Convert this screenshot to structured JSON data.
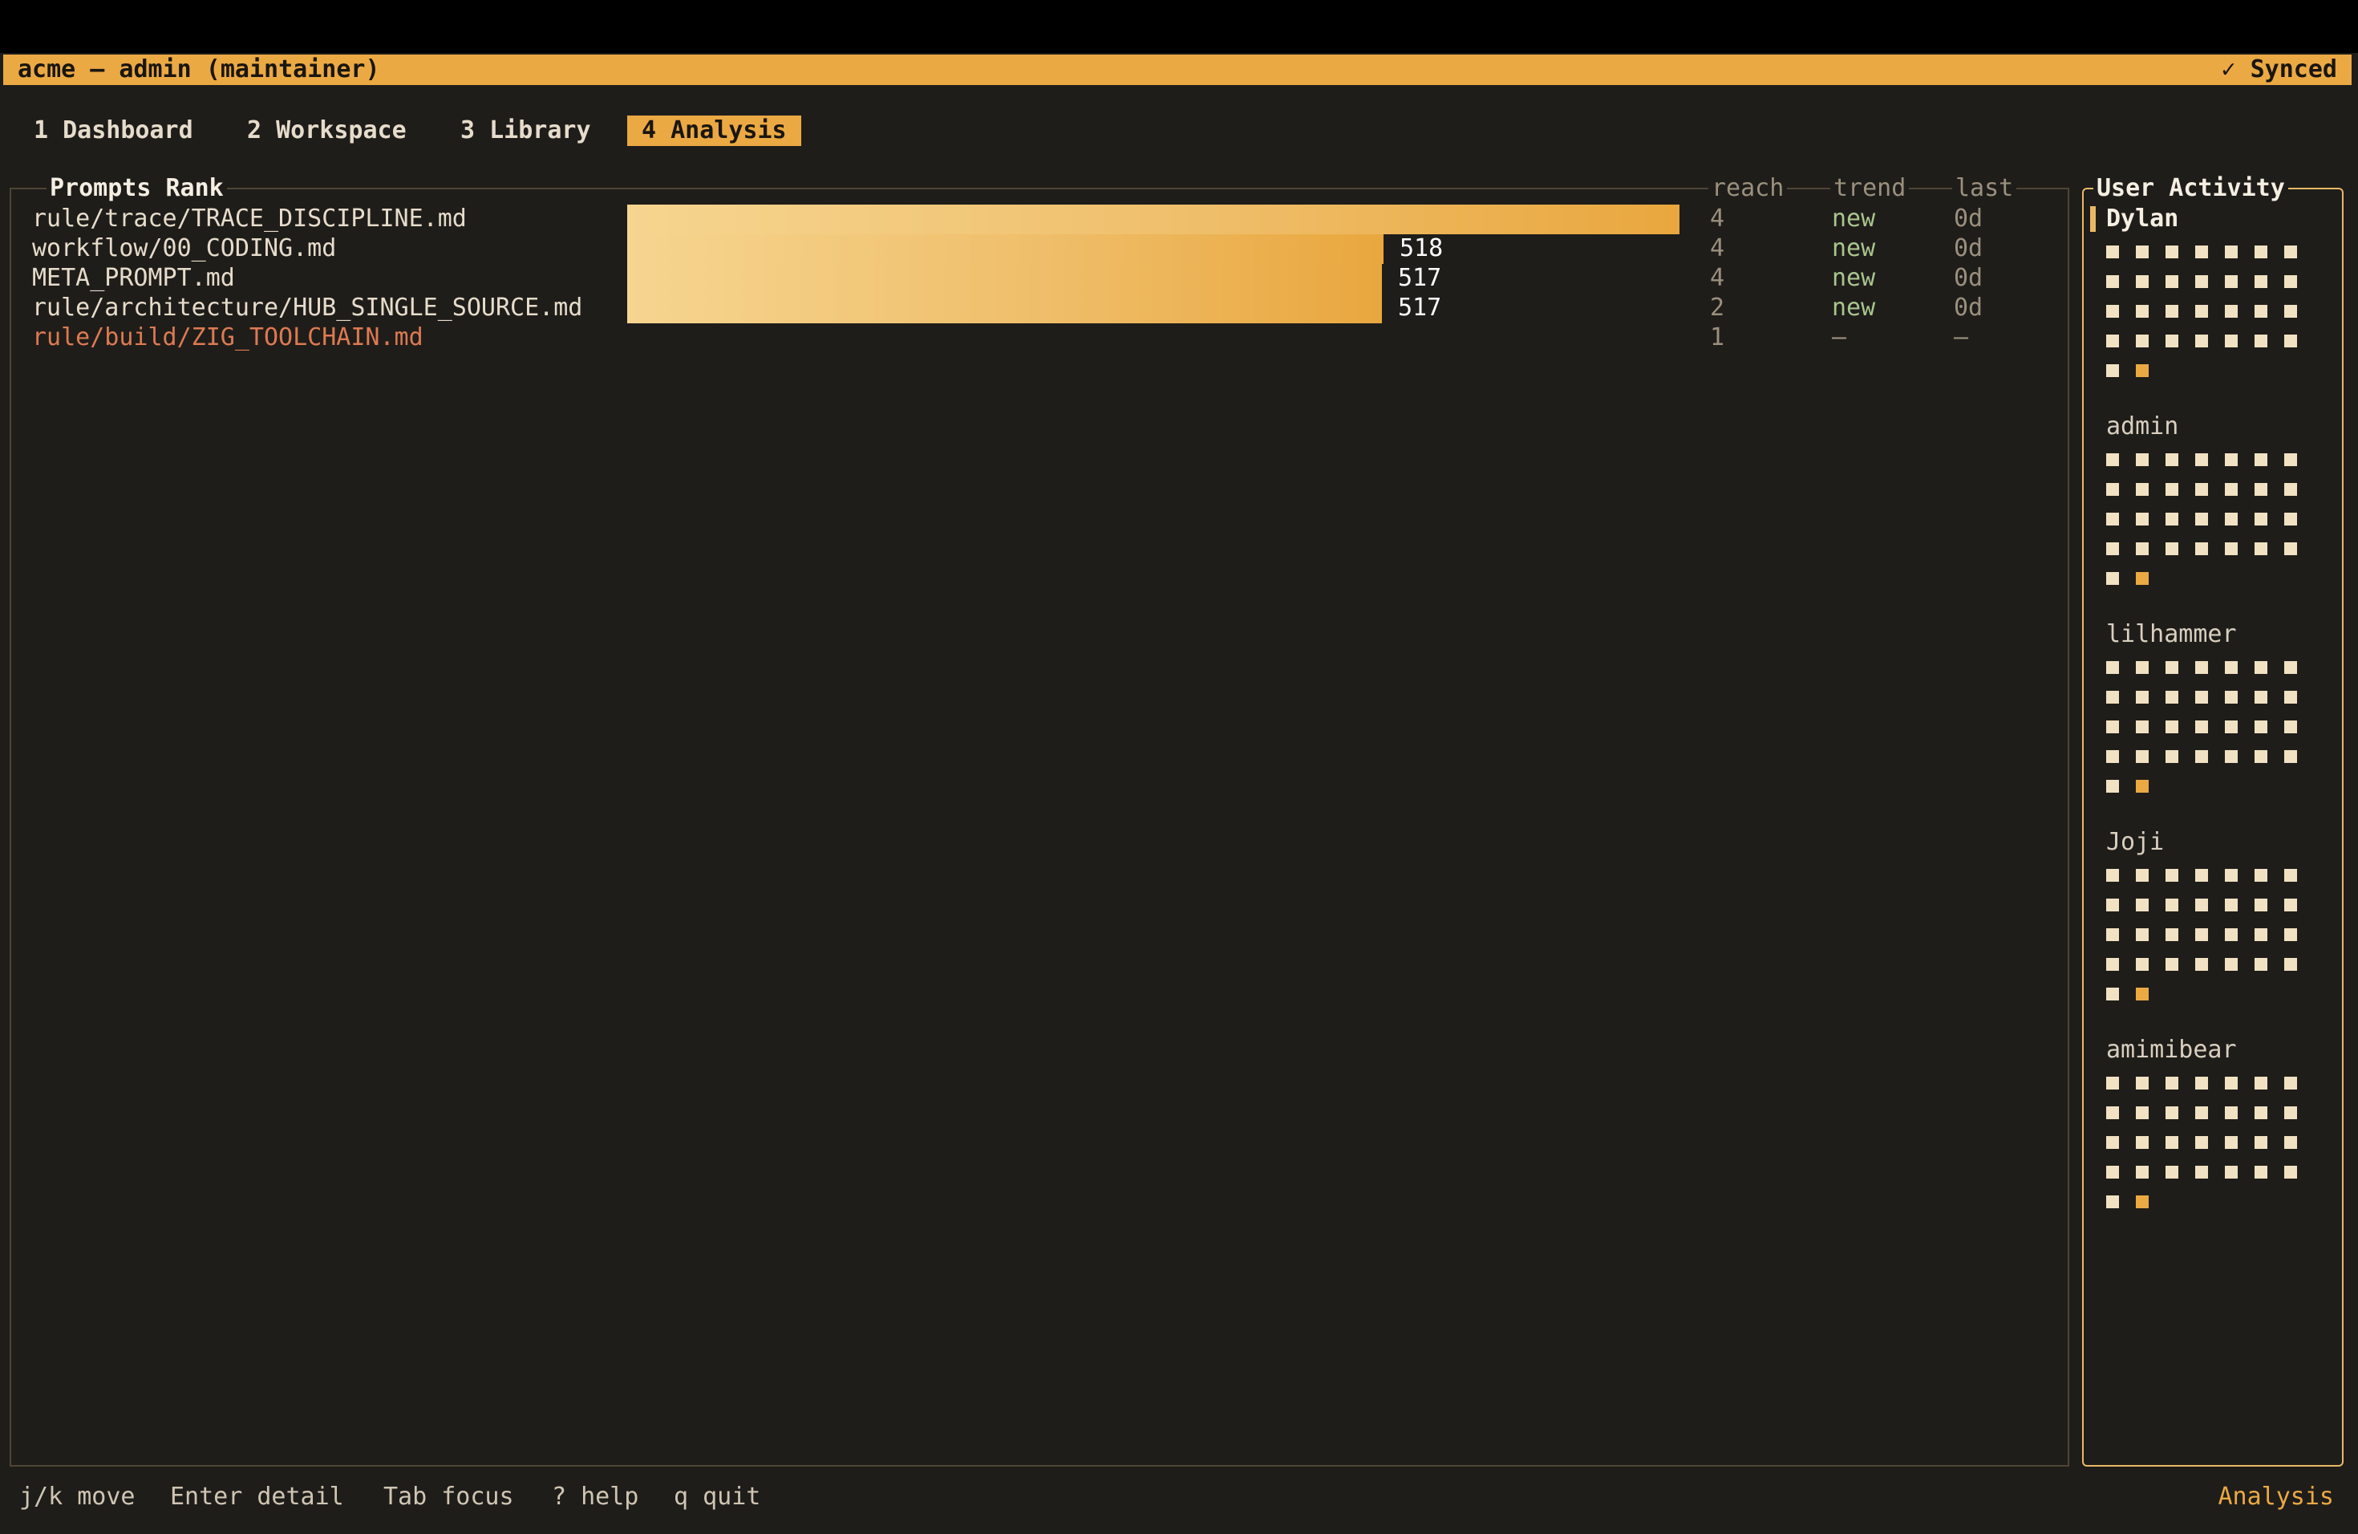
{
  "header": {
    "title": "acme — admin (maintainer)",
    "status": "✓ Synced"
  },
  "tabs": [
    {
      "label": "1 Dashboard"
    },
    {
      "label": "2 Workspace"
    },
    {
      "label": "3 Library"
    },
    {
      "label": "4 Analysis",
      "active": true
    }
  ],
  "prompts_rank": {
    "title": "Prompts Rank",
    "columns": {
      "reach": "reach",
      "trend": "trend",
      "last": "last"
    },
    "max_count": 721,
    "rows": [
      {
        "name": "rule/trace/TRACE_DISCIPLINE.md",
        "count": 721,
        "count_label": "",
        "reach": "4",
        "trend": "new",
        "last": "0d"
      },
      {
        "name": "workflow/00_CODING.md",
        "count": 518,
        "count_label": "518",
        "reach": "4",
        "trend": "new",
        "last": "0d"
      },
      {
        "name": "META_PROMPT.md",
        "count": 517,
        "count_label": "517",
        "reach": "4",
        "trend": "new",
        "last": "0d"
      },
      {
        "name": "rule/architecture/HUB_SINGLE_SOURCE.md",
        "count": 517,
        "count_label": "517",
        "reach": "2",
        "trend": "new",
        "last": "0d"
      },
      {
        "name": "rule/build/ZIG_TOOLCHAIN.md",
        "count": 0,
        "count_label": "",
        "reach": "1",
        "trend": "–",
        "last": "–",
        "warn": true
      }
    ]
  },
  "user_activity": {
    "title": "User Activity",
    "users": [
      {
        "name": "Dylan",
        "selected": true
      },
      {
        "name": "admin"
      },
      {
        "name": "lilhammer"
      },
      {
        "name": "Joji"
      },
      {
        "name": "amimibear"
      }
    ]
  },
  "footer": {
    "hints": [
      "j/k move",
      "Enter detail",
      "Tab focus",
      "? help",
      "q quit"
    ],
    "mode": "Analysis"
  },
  "colors": {
    "accent": "#eba944",
    "background": "#1f1d1a",
    "trend_new": "#a9c58e",
    "warning_text": "#dd7a52",
    "activity_dot": "#f0e2c2"
  }
}
